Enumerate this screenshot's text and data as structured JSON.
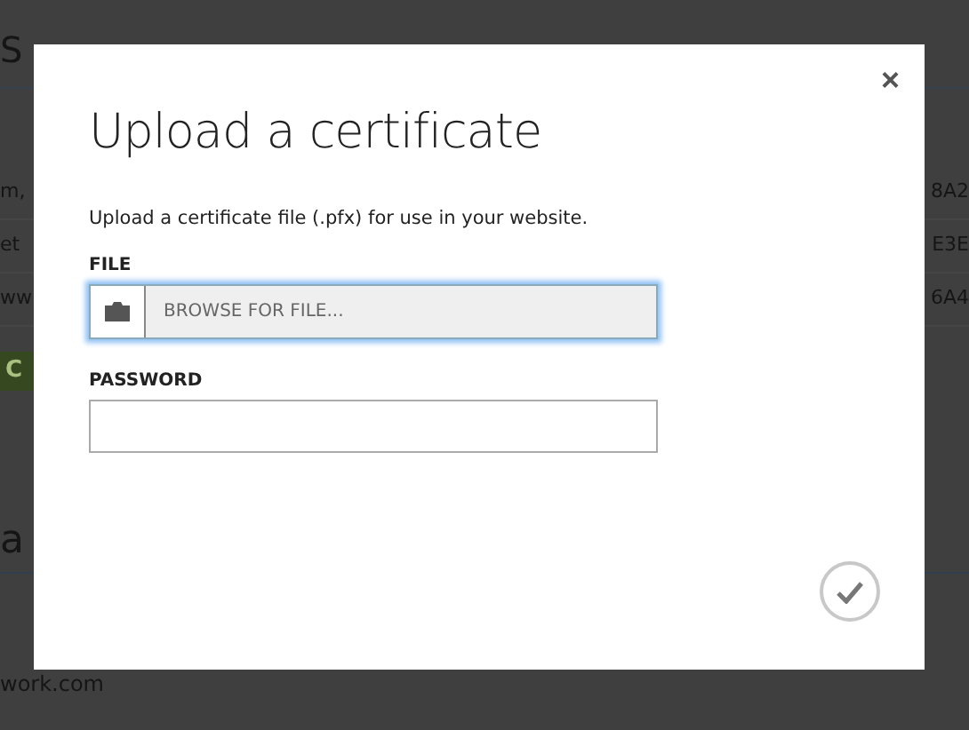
{
  "background": {
    "heading": "S",
    "rows": [
      {
        "left": "m,",
        "right": "8A2"
      },
      {
        "left": "et",
        "right": "E3E"
      },
      {
        "left": "ww",
        "right": "6A4"
      }
    ],
    "button": "C",
    "section_heading": "a",
    "footer_row": "work.com"
  },
  "dialog": {
    "close": "×",
    "title": "Upload a certificate",
    "description": "Upload a certificate file (.pfx) for use in your website.",
    "file": {
      "label": "FILE",
      "placeholder": "BROWSE FOR FILE...",
      "focused": true
    },
    "password": {
      "label": "PASSWORD"
    },
    "confirm": {
      "disabled": true
    }
  }
}
